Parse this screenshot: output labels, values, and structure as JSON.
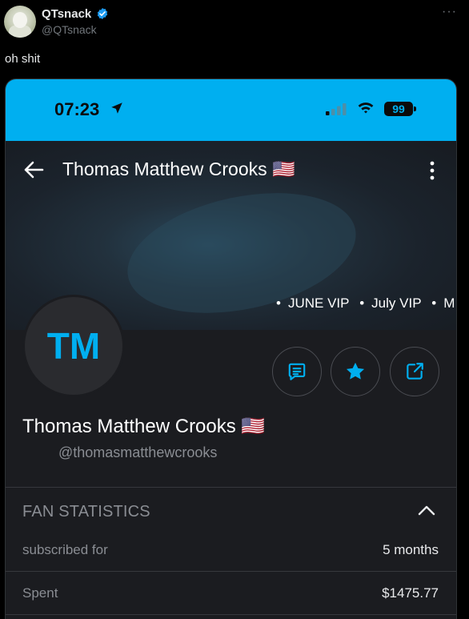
{
  "tweet": {
    "display_name": "QTsnack",
    "handle": "@QTsnack",
    "more_icon": "more-horizontal-icon",
    "text": "oh shit"
  },
  "phone": {
    "status_bar": {
      "time": "07:23",
      "battery": "99",
      "background_color": "#00aff0"
    },
    "header": {
      "title": "Thomas Matthew Crooks 🇺🇸",
      "back_icon": "arrow-left-icon",
      "menu_icon": "kebab-menu-icon"
    },
    "tags": [
      "JUNE VIP",
      "July VIP",
      "M"
    ],
    "profile": {
      "initials": "TM",
      "name": "Thomas Matthew Crooks 🇺🇸",
      "handle": "@thomasmatthewcrooks",
      "accent_color": "#00aff0"
    },
    "actions": [
      {
        "icon": "message-icon"
      },
      {
        "icon": "star-icon"
      },
      {
        "icon": "share-icon"
      }
    ],
    "fan_statistics": {
      "title": "FAN STATISTICS",
      "rows": [
        {
          "label": "subscribed for",
          "value": "5 months"
        },
        {
          "label": "Spent",
          "value": "$1475.77"
        }
      ]
    }
  }
}
